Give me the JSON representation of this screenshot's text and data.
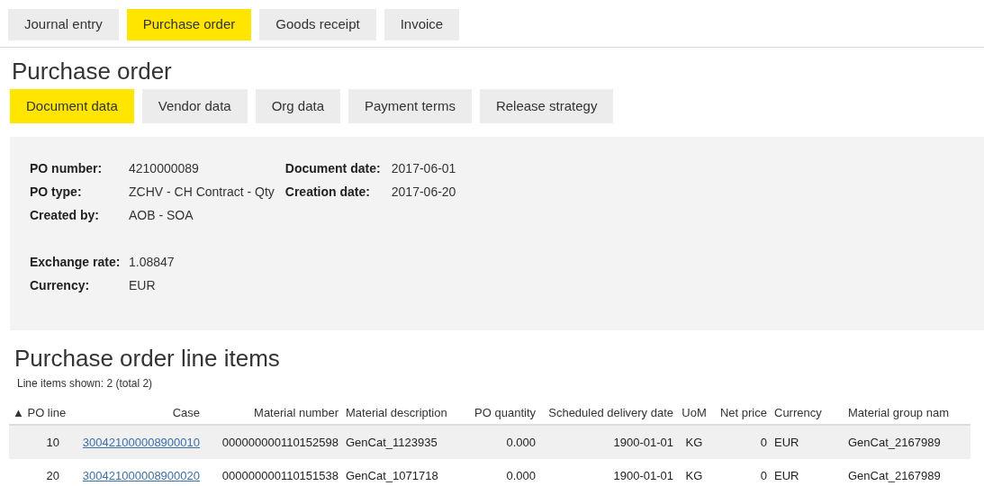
{
  "top_tabs": [
    {
      "label": "Journal entry",
      "selected": false
    },
    {
      "label": "Purchase order",
      "selected": true
    },
    {
      "label": "Goods receipt",
      "selected": false
    },
    {
      "label": "Invoice",
      "selected": false
    }
  ],
  "title": "Purchase order",
  "sub_tabs": [
    {
      "label": "Document data",
      "selected": true
    },
    {
      "label": "Vendor data",
      "selected": false
    },
    {
      "label": "Org data",
      "selected": false
    },
    {
      "label": "Payment terms",
      "selected": false
    },
    {
      "label": "Release strategy",
      "selected": false
    }
  ],
  "document_data": {
    "left_fields": [
      {
        "label": "PO number:",
        "value": "4210000089"
      },
      {
        "label": "PO type:",
        "value": "ZCHV - CH Contract - Qty"
      },
      {
        "label": "Created by:",
        "value": "AOB - SOA"
      }
    ],
    "right_fields": [
      {
        "label": "Document date:",
        "value": "2017-06-01"
      },
      {
        "label": "Creation date:",
        "value": "2017-06-20"
      }
    ],
    "rate_fields": [
      {
        "label": "Exchange rate:",
        "value": "1.08847"
      },
      {
        "label": "Currency:",
        "value": "EUR"
      }
    ]
  },
  "line_items": {
    "title": "Purchase order line items",
    "shown": "Line items shown: 2 (total 2)",
    "columns": [
      {
        "label": "▲ PO line",
        "kind": "text"
      },
      {
        "label": "Case",
        "kind": "link"
      },
      {
        "label": "Material number",
        "kind": "text"
      },
      {
        "label": "Material description",
        "kind": "text"
      },
      {
        "label": "PO quantity",
        "kind": "text"
      },
      {
        "label": "Scheduled delivery date",
        "kind": "text"
      },
      {
        "label": "UoM",
        "kind": "text"
      },
      {
        "label": "Net price",
        "kind": "text"
      },
      {
        "label": "Currency",
        "kind": "text"
      },
      {
        "label": "Material group nam",
        "kind": "text"
      }
    ],
    "rows": [
      [
        "10",
        "300421000008900010",
        "000000000110152598",
        "GenCat_1123935",
        "0.000",
        "1900-01-01",
        "KG",
        "0",
        "EUR",
        "GenCat_2167989"
      ],
      [
        "20",
        "300421000008900020",
        "000000000110151538",
        "GenCat_1071718",
        "0.000",
        "1900-01-01",
        "KG",
        "0",
        "EUR",
        "GenCat_2167989"
      ]
    ]
  }
}
